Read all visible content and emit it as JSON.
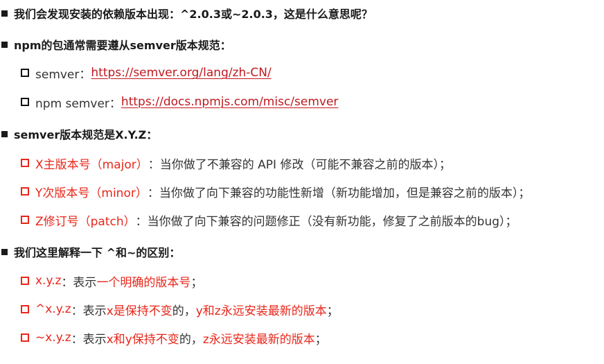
{
  "q1": "我们会发现安装的依赖版本出现：^2.0.3或~2.0.3，这是什么意思呢？",
  "q2": "npm的包通常需要遵从semver版本规范：",
  "links": [
    {
      "label": "semver：",
      "url": "https://semver.org/lang/zh-CN/"
    },
    {
      "label": "npm semver：",
      "url": "https://docs.npmjs.com/misc/semver"
    }
  ],
  "q3": "semver版本规范是X.Y.Z：",
  "xyz": [
    {
      "term": "X主版本号（major）",
      "desc": "：当你做了不兼容的 API 修改（可能不兼容之前的版本）；"
    },
    {
      "term": "Y次版本号（minor）",
      "desc": "：当你做了向下兼容的功能性新增（新功能增加，但是兼容之前的版本）；"
    },
    {
      "term": "Z修订号（patch）",
      "desc": "：当你做了向下兼容的问题修正（没有新功能，修复了之前版本的bug）；"
    }
  ],
  "q4": "我们这里解释一下 ^和~的区别：",
  "diff": [
    {
      "parts": [
        {
          "text": "x.y.z",
          "color": "red"
        },
        {
          "text": "：表示",
          "color": "normal"
        },
        {
          "text": "一个明确的版本号",
          "color": "red"
        },
        {
          "text": "；",
          "color": "normal"
        }
      ]
    },
    {
      "parts": [
        {
          "text": "^x.y.z",
          "color": "red"
        },
        {
          "text": "：表示",
          "color": "normal"
        },
        {
          "text": "x是保持不变",
          "color": "red"
        },
        {
          "text": "的，",
          "color": "normal"
        },
        {
          "text": "y和z永远安装最新的版本",
          "color": "red"
        },
        {
          "text": "；",
          "color": "normal"
        }
      ]
    },
    {
      "parts": [
        {
          "text": "~x.y.z",
          "color": "red"
        },
        {
          "text": "：表示",
          "color": "normal"
        },
        {
          "text": "x和y保持不变",
          "color": "red"
        },
        {
          "text": "的，",
          "color": "normal"
        },
        {
          "text": "z永远安装最新的版本",
          "color": "red"
        },
        {
          "text": "；",
          "color": "normal"
        }
      ]
    }
  ],
  "colors": {
    "accent_red": "#e8261a",
    "link_red": "#c0191e",
    "text": "#333333"
  }
}
